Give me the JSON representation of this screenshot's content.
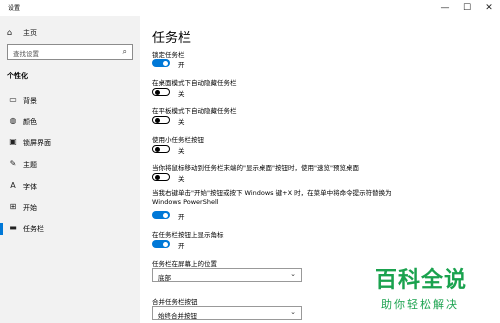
{
  "window": {
    "title": "设置",
    "minimize_icon": "—",
    "maximize_icon": "☐",
    "close_icon": "✕"
  },
  "sidebar": {
    "home_label": "主页",
    "home_icon": "⌂",
    "search_placeholder": "查找设置",
    "search_icon": "⌕",
    "section_title": "个性化",
    "items": [
      {
        "label": "背景",
        "icon": "▭"
      },
      {
        "label": "颜色",
        "icon": "◍"
      },
      {
        "label": "锁屏界面",
        "icon": "▣"
      },
      {
        "label": "主题",
        "icon": "✎"
      },
      {
        "label": "字体",
        "icon": "A"
      },
      {
        "label": "开始",
        "icon": "⊞"
      },
      {
        "label": "任务栏",
        "icon": "▬"
      }
    ],
    "active_index": 6
  },
  "main": {
    "title": "任务栏",
    "options": [
      {
        "label": "锁定任务栏",
        "state": "开",
        "on": true
      },
      {
        "label": "在桌面模式下自动隐藏任务栏",
        "state": "关",
        "on": false
      },
      {
        "label": "在平板模式下自动隐藏任务栏",
        "state": "关",
        "on": false
      },
      {
        "label": "使用小任务栏按钮",
        "state": "关",
        "on": false
      },
      {
        "label": "当你将鼠标移动到任务栏末端的\"显示桌面\"按钮时，使用\"速览\"预览桌面",
        "state": "关",
        "on": false
      },
      {
        "label": "当我右键单击\"开始\"按钮或按下 Windows 键+X 时，在菜单中将命令提示符替换为 Windows PowerShell",
        "state": "开",
        "on": true
      },
      {
        "label": "在任务栏按钮上显示角标",
        "state": "开",
        "on": true
      }
    ],
    "position": {
      "label": "任务栏在屏幕上的位置",
      "value": "底部"
    },
    "combine": {
      "label": "合并任务栏按钮",
      "value": "始终合并按钮"
    }
  },
  "watermark": {
    "title": "百科全说",
    "subtitle": "助你轻松解决"
  },
  "colors": {
    "accent": "#0078d7",
    "sidebar_bg": "#f2f2f2",
    "watermark": "#1aa24e"
  }
}
